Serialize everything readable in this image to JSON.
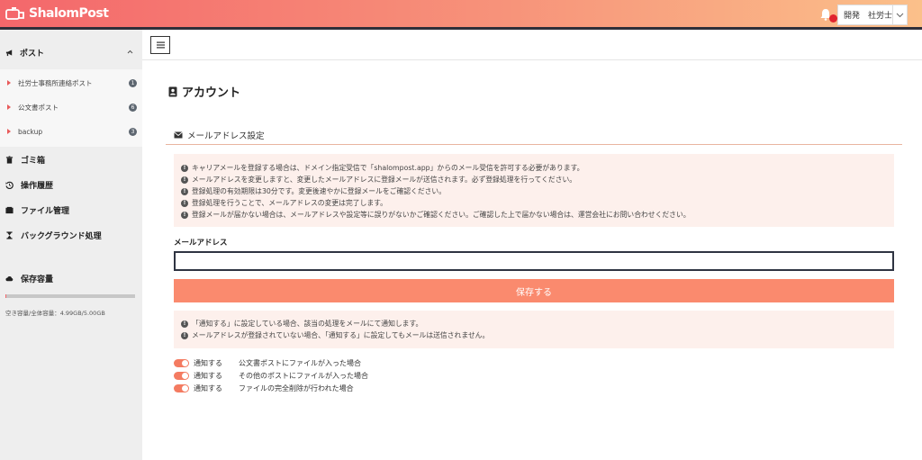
{
  "app": {
    "logo_text": "ShalomPost"
  },
  "header": {
    "user_name": "開発　社労士",
    "bell_icon": "bell-icon",
    "accent_color": "#f4676b"
  },
  "sidebar": {
    "post_header": "ポスト",
    "posts": [
      {
        "label": "社労士事務所連絡ポスト",
        "count": "1"
      },
      {
        "label": "公文書ポスト",
        "count": "6"
      },
      {
        "label": "backup",
        "count": "3"
      }
    ],
    "nav": [
      {
        "label": "ゴミ箱",
        "icon": "trash-icon"
      },
      {
        "label": "操作履歴",
        "icon": "history-icon"
      },
      {
        "label": "ファイル管理",
        "icon": "folder-icon"
      },
      {
        "label": "バックグラウンド処理",
        "icon": "hourglass-icon"
      }
    ],
    "storage": {
      "title": "保存容量",
      "text": "空き容量/全体容量：4.99GB/5.00GB",
      "used_fraction": 0.002
    }
  },
  "main": {
    "page_title": "アカウント",
    "section_title": "メールアドレス設定",
    "notices": [
      "キャリアメールを登録する場合は、ドメイン指定受信で「shalompost.app」からのメール受信を許可する必要があります。",
      "メールアドレスを変更しますと、変更したメールアドレスに登録メールが送信されます。必ず登録処理を行ってください。",
      "登録処理の有効期限は30分です。変更後速やかに登録メールをご確認ください。",
      "登録処理を行うことで、メールアドレスの変更は完了します。",
      "登録メールが届かない場合は、メールアドレスや設定等に誤りがないかご確認ください。ご確認した上で届かない場合は、運営会社にお問い合わせください。"
    ],
    "email_label": "メールアドレス",
    "email_value": "",
    "save_label": "保存する",
    "notify_notices": [
      "「通知する」に設定している場合、該当の処理をメールにて通知します。",
      "メールアドレスが登録されていない場合、「通知する」に設定してもメールは送信されません。"
    ],
    "toggles": [
      {
        "state": "通知する",
        "desc": "公文書ポストにファイルが入った場合",
        "on": true
      },
      {
        "state": "通知する",
        "desc": "その他のポストにファイルが入った場合",
        "on": true
      },
      {
        "state": "通知する",
        "desc": "ファイルの完全削除が行われた場合",
        "on": true
      }
    ]
  }
}
